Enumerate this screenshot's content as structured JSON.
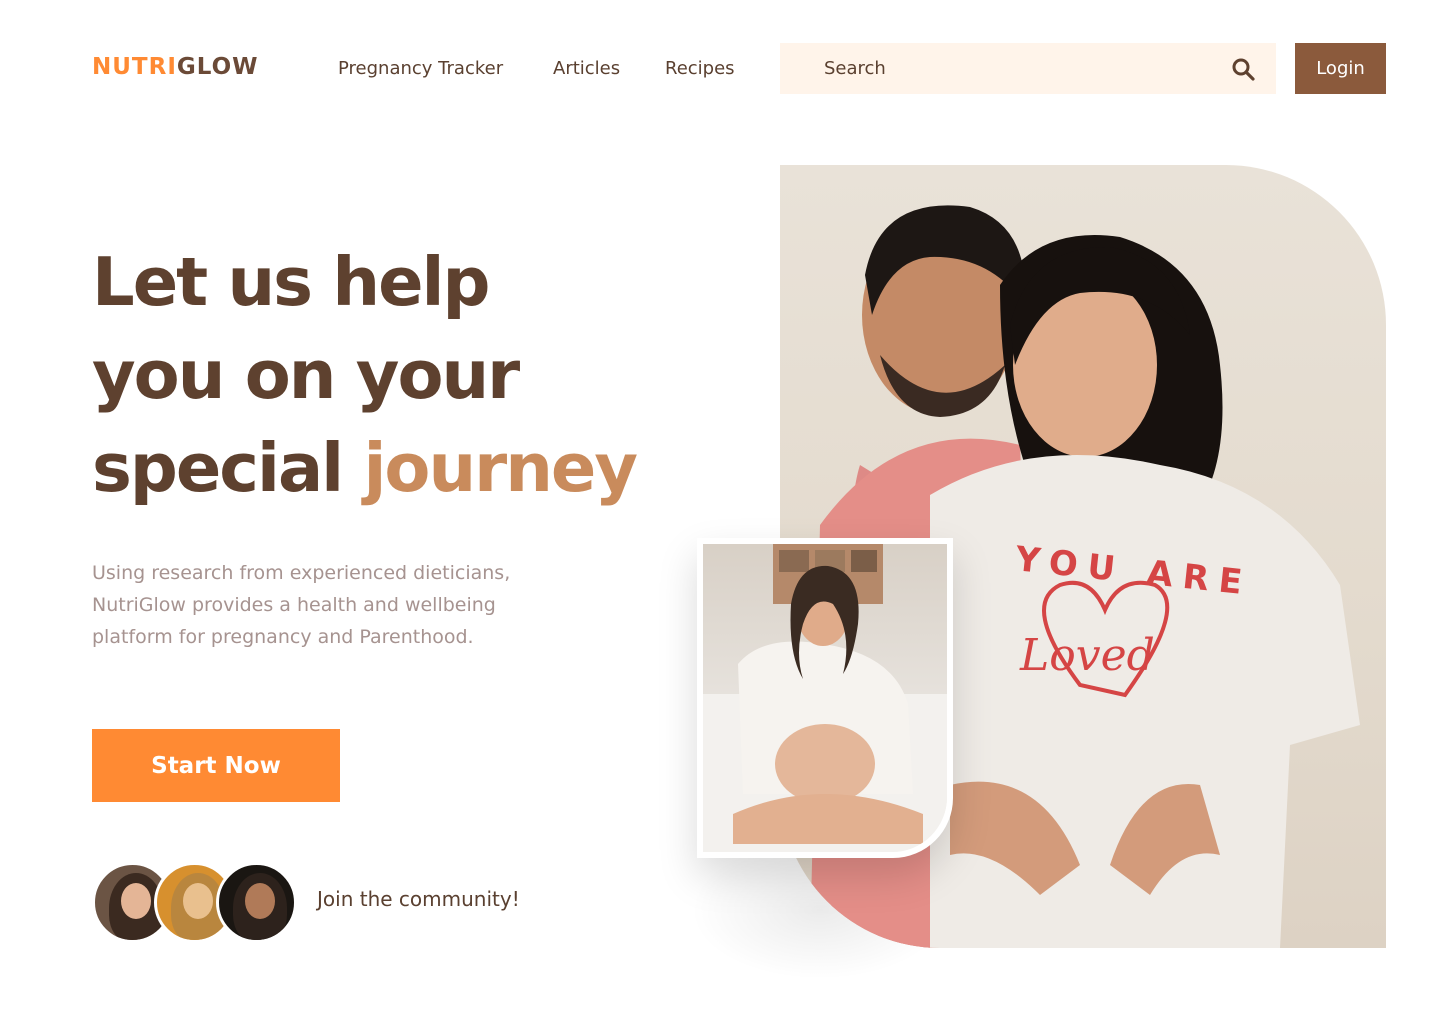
{
  "brand": {
    "part1": "NUTRI",
    "part2": "GLOW"
  },
  "nav": {
    "items": [
      {
        "label": "Pregnancy Tracker"
      },
      {
        "label": "Articles"
      },
      {
        "label": "Recipes"
      }
    ],
    "search_placeholder": "Search",
    "login_label": "Login"
  },
  "hero": {
    "headline_line1": "Let us help",
    "headline_line2": "you on your",
    "headline_line3_a": "special",
    "headline_line3_b": "journey",
    "description": "Using research from experienced dieticians, NutriGlow provides a health and wellbeing platform for pregnancy and Parenthood.",
    "cta_label": "Start Now",
    "community_label": "Join the community!",
    "main_shirt_text_1": "YOU ARE",
    "main_shirt_text_2": "Loved"
  },
  "colors": {
    "accent_orange": "#ff8a33",
    "brand_brown": "#6b4a37",
    "button_brown": "#8b5a3c",
    "headline_brown": "#5e412f",
    "highlight_tan": "#c98b5c",
    "search_bg": "#fff4ea"
  }
}
